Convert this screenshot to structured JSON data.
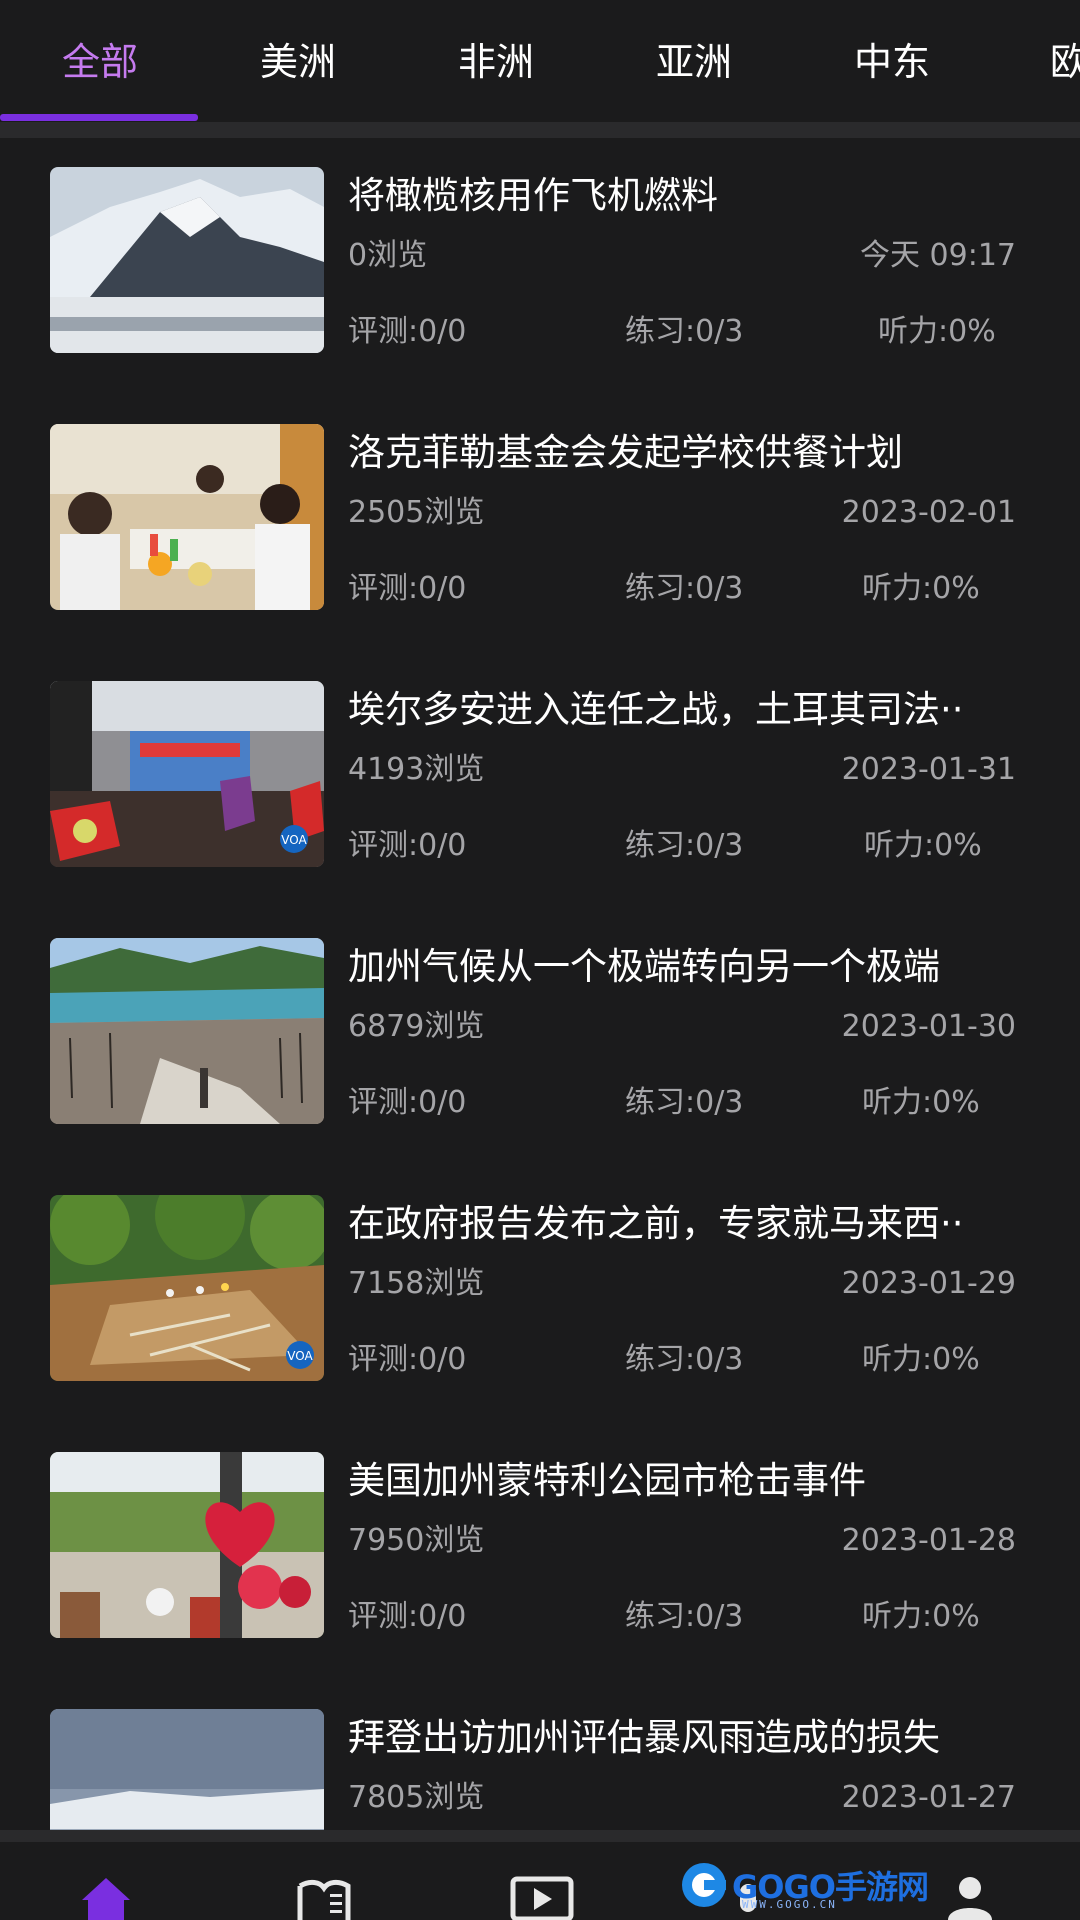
{
  "tabs": [
    {
      "label": "全部",
      "active": true
    },
    {
      "label": "美洲",
      "active": false
    },
    {
      "label": "非洲",
      "active": false
    },
    {
      "label": "亚洲",
      "active": false
    },
    {
      "label": "中东",
      "active": false
    },
    {
      "label": "欧",
      "active": false
    }
  ],
  "colors": {
    "background": "#1b1b1c",
    "accent_text": "#c57bef",
    "accent_bar": "#7a2fe0",
    "secondary_text": "#a5a5a8"
  },
  "articles": [
    {
      "title": "将橄榄核用作飞机燃料",
      "views": "0浏览",
      "date": "今天 09:17",
      "eval": "评测:0/0",
      "practice": "练习:0/3",
      "listening": "听力:0%",
      "thumb": "snowy-mountain"
    },
    {
      "title": "洛克菲勒基金会发起学校供餐计划",
      "views": "2505浏览",
      "date": "2023-02-01",
      "eval": "评测:0/0",
      "practice": "练习:0/3",
      "listening": "听力:0%",
      "thumb": "school-children"
    },
    {
      "title": "埃尔多安进入连任之战，土耳其司法··",
      "views": "4193浏览",
      "date": "2023-01-31",
      "eval": "评测:0/0",
      "practice": "练习:0/3",
      "listening": "听力:0%",
      "thumb": "rally-stage"
    },
    {
      "title": "加州气候从一个极端转向另一个极端",
      "views": "6879浏览",
      "date": "2023-01-30",
      "eval": "评测:0/0",
      "practice": "练习:0/3",
      "listening": "听力:0%",
      "thumb": "burnt-hills-lake"
    },
    {
      "title": "在政府报告发布之前，专家就马来西··",
      "views": "7158浏览",
      "date": "2023-01-29",
      "eval": "评测:0/0",
      "practice": "练习:0/3",
      "listening": "听力:0%",
      "thumb": "landslide-rescue"
    },
    {
      "title": "美国加州蒙特利公园市枪击事件",
      "views": "7950浏览",
      "date": "2023-01-28",
      "eval": "评测:0/0",
      "practice": "练习:0/3",
      "listening": "听力:0%",
      "thumb": "memorial-balloons"
    },
    {
      "title": "拜登出访加州评估暴风雨造成的损失",
      "views": "7805浏览",
      "date": "2023-01-27",
      "eval": "",
      "practice": "",
      "listening": "",
      "thumb": "stormy-sky"
    }
  ],
  "bottom_nav": [
    {
      "icon": "home-icon",
      "active": true
    },
    {
      "icon": "book-icon",
      "active": false
    },
    {
      "icon": "video-play-icon",
      "active": false
    },
    {
      "icon": "microphone-icon",
      "active": false
    },
    {
      "icon": "user-icon",
      "active": false
    }
  ],
  "watermark": {
    "text": "GOGO手游网",
    "sub": "WWW.GOGO.CN"
  }
}
